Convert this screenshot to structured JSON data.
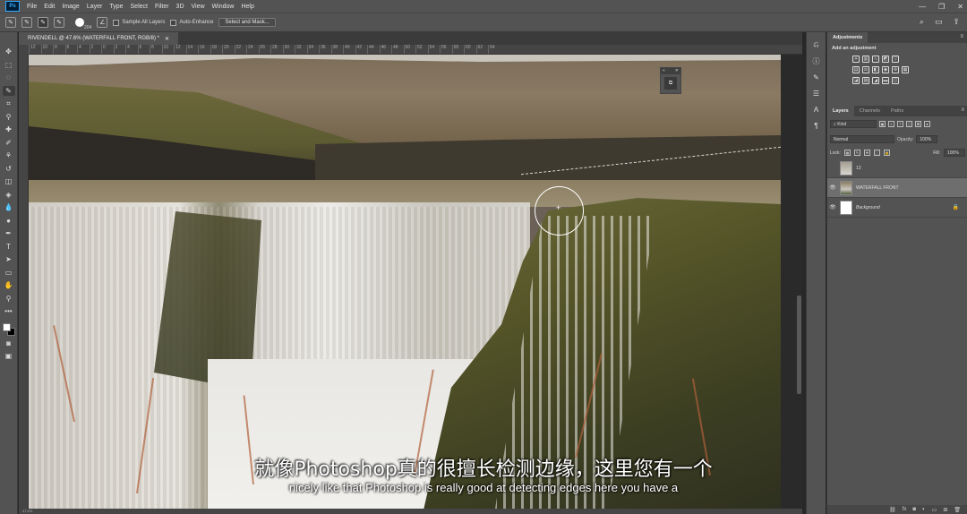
{
  "menubar": {
    "logo": "Ps",
    "items": [
      "File",
      "Edit",
      "Image",
      "Layer",
      "Type",
      "Select",
      "Filter",
      "3D",
      "View",
      "Window",
      "Help"
    ],
    "window_controls": [
      "—",
      "❐",
      "✕"
    ]
  },
  "options": {
    "brush_size": "204",
    "sample_all_layers": "Sample All Layers",
    "auto_enhance": "Auto-Enhance",
    "select_and_mask": "Select and Mask..."
  },
  "document": {
    "tab_title": "RIVENDELL @ 47.6% (WATERFALL FRONT, RGB/8) *",
    "close": "✕",
    "ruler_ticks": [
      "12",
      "10",
      "8",
      "6",
      "4",
      "2",
      "0",
      "2",
      "4",
      "6",
      "8",
      "10",
      "12",
      "14",
      "16",
      "18",
      "20",
      "22",
      "24",
      "26",
      "28",
      "30",
      "32",
      "34",
      "36",
      "38",
      "40",
      "42",
      "44",
      "46",
      "48",
      "50",
      "52",
      "54",
      "56",
      "58",
      "60",
      "62",
      "64"
    ],
    "status": "47.6%"
  },
  "subtitles": {
    "zh": "就像Photoshop真的很擅长检测边缘，这里您有一个",
    "en": "nicely like that Photoshop is really good at detecting edges here you have a"
  },
  "adjustments": {
    "tab": "Adjustments",
    "add_label": "Add an adjustment"
  },
  "layers_panel": {
    "tabs": [
      "Layers",
      "Channels",
      "Paths"
    ],
    "kind": "Kind",
    "blend_mode": "Normal",
    "opacity_label": "Opacity:",
    "opacity": "100%",
    "lock_label": "Lock:",
    "fill_label": "Fill:",
    "fill": "100%",
    "layers": [
      {
        "name": "13",
        "visible": false,
        "selected": false,
        "italic": false
      },
      {
        "name": "WATERFALL FRONT",
        "visible": true,
        "selected": true,
        "italic": false
      },
      {
        "name": "Background",
        "visible": true,
        "selected": false,
        "italic": true,
        "locked": true
      }
    ]
  },
  "colors": {
    "ui_bg": "#535353",
    "panel_dark": "#424242",
    "selection": "#ffffff",
    "ps_blue": "#31a8ff"
  }
}
